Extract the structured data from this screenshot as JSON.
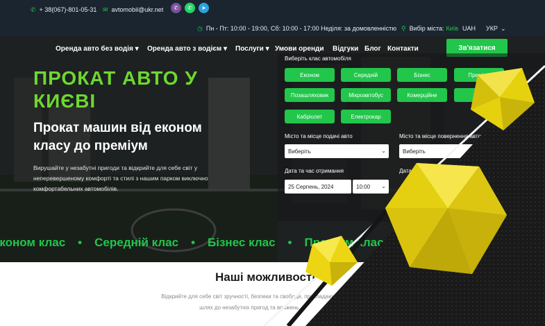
{
  "topbar": {
    "phone": "+ 38(067)-801-05-31",
    "email": "avtomobil@ukr.net",
    "hours": "Пн - Пт: 10:00 - 19:00, Сб: 10:00 - 17:00 Неділя: за домовленністю",
    "city_label": "Вибір міста:",
    "city": "Київ",
    "currency": "UAH",
    "language": "УКР"
  },
  "nav": {
    "items": [
      "Оренда авто без водія",
      "Оренда авто з водієм",
      "Послуги",
      "Умови оренди",
      "Відгуки",
      "Блог",
      "Контакти"
    ],
    "cta": "Зв'язатися"
  },
  "hero": {
    "title_line1": "ПРОКАТ АВТО У",
    "title_line2": "КИЄВІ",
    "subtitle_line1": "Прокат машин від економ",
    "subtitle_line2": "класу до преміум",
    "description": "Вирушайте у незабутні пригоди та відкрийте для себе світ у неперевершеному комфорті та стилі з нашим парком виключно комфортабельних автомобілів."
  },
  "booking": {
    "class_label": "Виберіть клас автомобіля",
    "classes": [
      "Економ",
      "Середній",
      "Бізнес",
      "Преміум",
      "Позашляховик",
      "Мікроавтобус",
      "Комерційне",
      "",
      "Кабріолет",
      "Електрокар"
    ],
    "pickup_label": "Місто та місце подачі авто",
    "pickup_value": "Виберіть",
    "return_label": "Місто та місце повернення авто",
    "return_value": "Виберіть",
    "date_label": "Дата та час отримання",
    "date_value": "25 Серпень, 2024",
    "time_value": "10:00",
    "return_date_label": "Дата"
  },
  "ticker": {
    "items": [
      "Економ клас",
      "Середній клас",
      "Бізнес клас",
      "Преміум клас"
    ]
  },
  "section": {
    "title": "Наші можливості",
    "description": "Відкрийте для себе світ зручності, безпеки та свободи, прокладаючи шлях до незабутніх пригод та вражень."
  },
  "colors": {
    "accent": "#21c64b",
    "title_green": "#6ed82f",
    "topbar": "#1b2530",
    "shape_yellow": "#f1dd12"
  }
}
